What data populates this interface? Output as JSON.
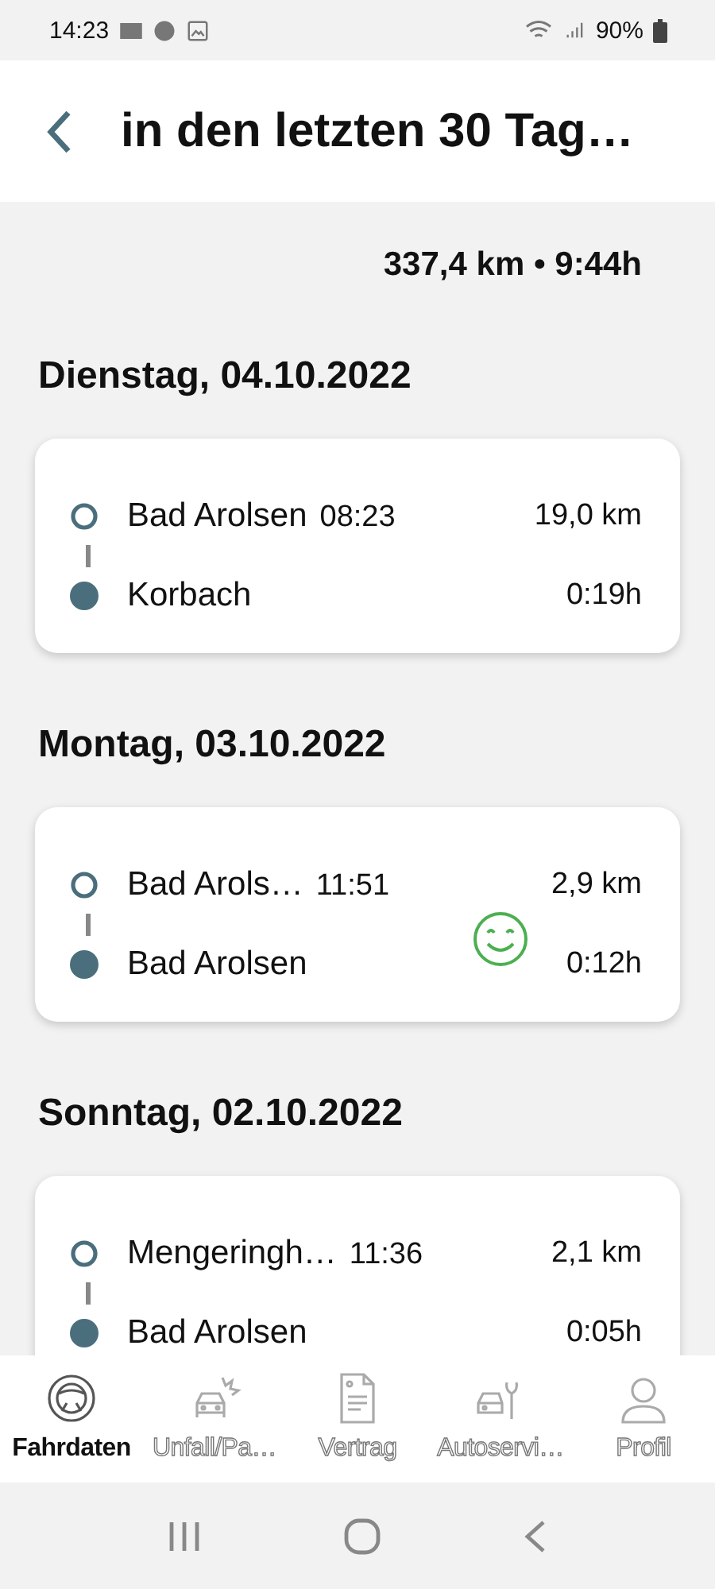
{
  "status_bar": {
    "time": "14:23",
    "battery": "90%"
  },
  "header": {
    "title": "in den letzten 30 Tag…"
  },
  "summary": "337,4 km • 9:44h",
  "days": [
    {
      "date": "Dienstag, 04.10.2022",
      "trips": [
        {
          "from": "Bad Arolsen",
          "time": "08:23",
          "to": "Korbach",
          "distance": "19,0 km",
          "duration": "0:19h",
          "smiley": false
        }
      ]
    },
    {
      "date": "Montag, 03.10.2022",
      "trips": [
        {
          "from": "Bad Arols…",
          "time": "11:51",
          "to": "Bad Arolsen",
          "distance": "2,9 km",
          "duration": "0:12h",
          "smiley": true
        }
      ]
    },
    {
      "date": "Sonntag, 02.10.2022",
      "trips": [
        {
          "from": "Mengeringh…",
          "time": "11:36",
          "to": "Bad Arolsen",
          "distance": "2,1 km",
          "duration": "0:05h",
          "smiley": false
        }
      ]
    }
  ],
  "nav": [
    {
      "label": "Fahrdaten",
      "kind": "wheel",
      "selected": true
    },
    {
      "label": "Unfall/Pa…",
      "kind": "crash",
      "selected": false
    },
    {
      "label": "Vertrag",
      "kind": "doc",
      "selected": false
    },
    {
      "label": "Autoservi…",
      "kind": "service",
      "selected": false
    },
    {
      "label": "Profil",
      "kind": "person",
      "selected": false
    }
  ]
}
